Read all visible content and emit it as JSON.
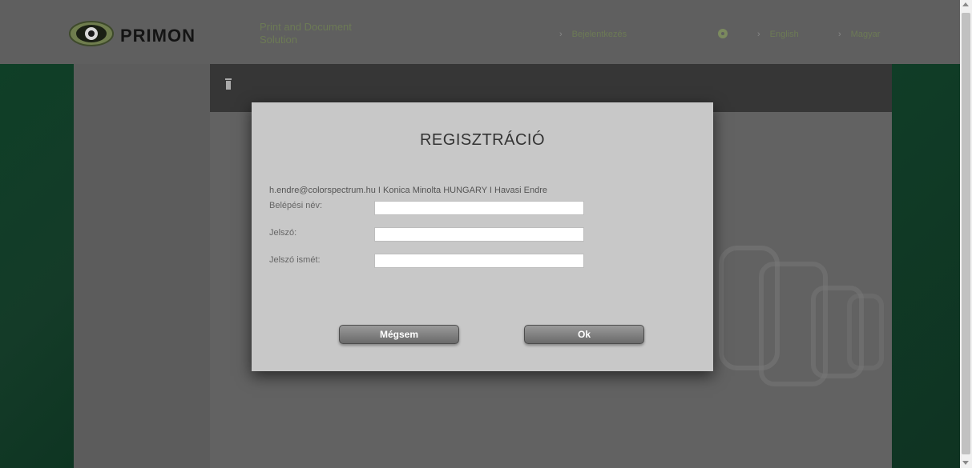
{
  "header": {
    "logo_text": "PRIMON",
    "tagline": "Print and Document Solution",
    "nav": {
      "login": "Bejelentkezés",
      "english": "English",
      "magyar": "Magyar"
    }
  },
  "dialog": {
    "title": "REGISZTRÁCIÓ",
    "info": "h.endre@colorspectrum.hu I Konica Minolta HUNGARY I Havasi Endre",
    "fields": {
      "username": {
        "label": "Belépési név:",
        "value": ""
      },
      "password": {
        "label": "Jelszó:",
        "value": ""
      },
      "password_repeat": {
        "label": "Jelszó ismét:",
        "value": ""
      }
    },
    "buttons": {
      "cancel": "Mégsem",
      "ok": "Ok"
    }
  },
  "colors": {
    "accent_green": "#6c7a55",
    "band_green": "#0f3f27",
    "dialog_bg": "#c8c8c8"
  },
  "icons": [
    "eye-logo-icon",
    "gear-icon",
    "trash-icon",
    "chevron-right-icon"
  ]
}
